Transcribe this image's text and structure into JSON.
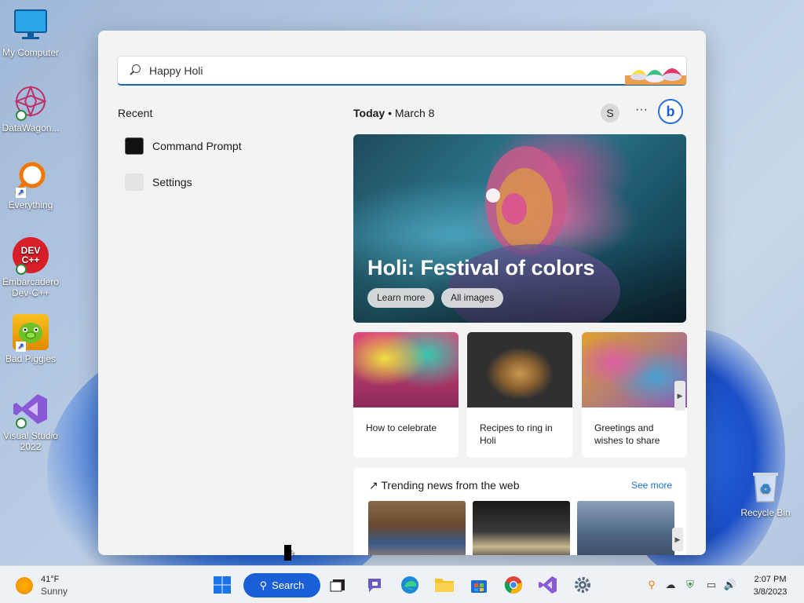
{
  "desktop": {
    "icons": [
      {
        "label": "My Computer",
        "icon": "monitor-icon"
      },
      {
        "label": "DataWagon...",
        "icon": "datawagon-icon"
      },
      {
        "label": "Everything",
        "icon": "everything-icon"
      },
      {
        "label": "Embarcadero Dev-C++",
        "icon": "devcpp-icon",
        "badge": "DEV C++"
      },
      {
        "label": "Bad Piggies",
        "icon": "bad-piggies-icon"
      },
      {
        "label": "Visual Studio 2022",
        "icon": "visual-studio-icon"
      },
      {
        "label": "Recycle Bin",
        "icon": "recycle-bin-icon"
      }
    ]
  },
  "search": {
    "query": "Happy Holi",
    "recent_title": "Recent",
    "recent": [
      {
        "label": "Command Prompt",
        "icon": "command-prompt-icon"
      },
      {
        "label": "Settings",
        "icon": "settings-icon"
      }
    ],
    "today_label": "Today",
    "date": "March 8",
    "avatar_letter": "S",
    "more": "···",
    "bing": "b",
    "hero": {
      "title": "Holi: Festival of colors",
      "learn_more": "Learn more",
      "all_images": "All images"
    },
    "cards": [
      {
        "caption": "How to celebrate"
      },
      {
        "caption": "Recipes to ring in Holi"
      },
      {
        "caption": "Greetings and wishes to share"
      }
    ],
    "trending": {
      "title": "Trending news from the web",
      "see_more": "See more"
    }
  },
  "taskbar": {
    "weather_temp": "41°F",
    "weather_desc": "Sunny",
    "search_label": "Search",
    "time": "2:07 PM",
    "date": "3/8/2023"
  }
}
